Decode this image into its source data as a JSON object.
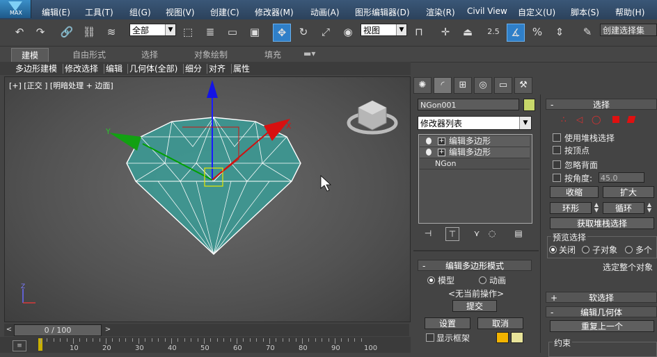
{
  "app": {
    "logo_text": "MAX"
  },
  "menu": [
    "编辑(E)",
    "工具(T)",
    "组(G)",
    "视图(V)",
    "创建(C)",
    "修改器(M)",
    "动画(A)",
    "图形编辑器(D)",
    "渲染(R)",
    "Civil View",
    "自定义(U)",
    "脚本(S)",
    "帮助(H)"
  ],
  "toolbar": {
    "selection_filter": "全部",
    "ref_coord": "视图",
    "snap_value": "2.5",
    "named_selection": "创建选择集"
  },
  "ribbon": {
    "tabs": [
      "建模",
      "自由形式",
      "选择",
      "对象绘制",
      "填充"
    ],
    "sub_items": [
      "多边形建模",
      "修改选择",
      "编辑",
      "几何体(全部)",
      "细分",
      "对齐",
      "属性"
    ]
  },
  "viewport": {
    "label": "[+] [正交 ] [明暗处理 + 边面]",
    "axis_x": "X",
    "axis_y": "Y",
    "axis_z": "Z"
  },
  "timeline": {
    "frame": "0 / 100",
    "ticks": [
      "10",
      "20",
      "30",
      "40",
      "50",
      "60",
      "70",
      "80",
      "90",
      "100"
    ]
  },
  "panel": {
    "object_name": "NGon001",
    "modifier_list": "修改器列表",
    "stack": [
      "编辑多边形",
      "编辑多边形",
      "NGon"
    ],
    "selection": {
      "title": "选择",
      "use_stack": "使用堆栈选择",
      "by_vertex": "按顶点",
      "ignore_back": "忽略背面",
      "by_angle": "按角度:",
      "angle_value": "45.0",
      "shrink": "收缩",
      "grow": "扩大",
      "ring": "环形",
      "loop": "循环",
      "get_stack": "获取堆栈选择",
      "preview_title": "预览选择",
      "preview_off": "关闭",
      "preview_sub": "子对象",
      "preview_multi": "多个",
      "select_whole": "选定整个对象"
    },
    "soft_select": "软选择",
    "edit_geometry": "编辑几何体",
    "repeat_last": "重复上一个",
    "constraints": "约束",
    "edit_poly_mode": {
      "title": "编辑多边形模式",
      "model": "模型",
      "animate": "动画",
      "no_op": "<无当前操作>",
      "commit": "提交",
      "settings": "设置",
      "cancel": "取消",
      "show_cage": "显示框架"
    }
  },
  "colors": {
    "accent": "#2f7fc8",
    "swatch": "#c8d86a",
    "cage1": "#f3b400",
    "cage2": "#e8e49a",
    "mesh": "#3fa9a3"
  }
}
